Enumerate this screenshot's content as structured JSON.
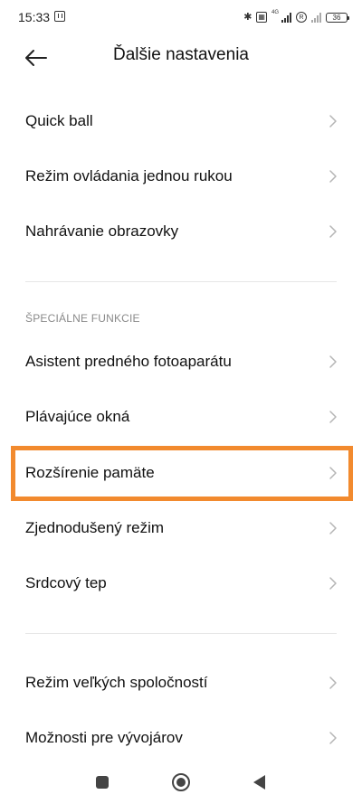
{
  "status_bar": {
    "time": "15:33",
    "network_label": "4G",
    "battery_level": "36"
  },
  "header": {
    "title": "Ďalšie nastavenia"
  },
  "items_top": [
    {
      "label": "Quick ball"
    },
    {
      "label": "Režim ovládania jednou rukou"
    },
    {
      "label": "Nahrávanie obrazovky"
    }
  ],
  "special_section": {
    "header": "ŠPECIÁLNE FUNKCIE",
    "items": [
      {
        "label": "Asistent predného fotoaparátu"
      },
      {
        "label": "Plávajúce okná"
      },
      {
        "label": "Rozšírenie pamäte",
        "highlighted": true
      },
      {
        "label": "Zjednodušený režim"
      },
      {
        "label": "Srdcový tep"
      }
    ]
  },
  "items_bottom": [
    {
      "label": "Režim veľkých spoločností"
    },
    {
      "label": "Možnosti pre vývojárov"
    }
  ],
  "colors": {
    "highlight": "#f28a2e",
    "section_header": "#8a8a8a",
    "chevron": "#b5b5b5"
  }
}
